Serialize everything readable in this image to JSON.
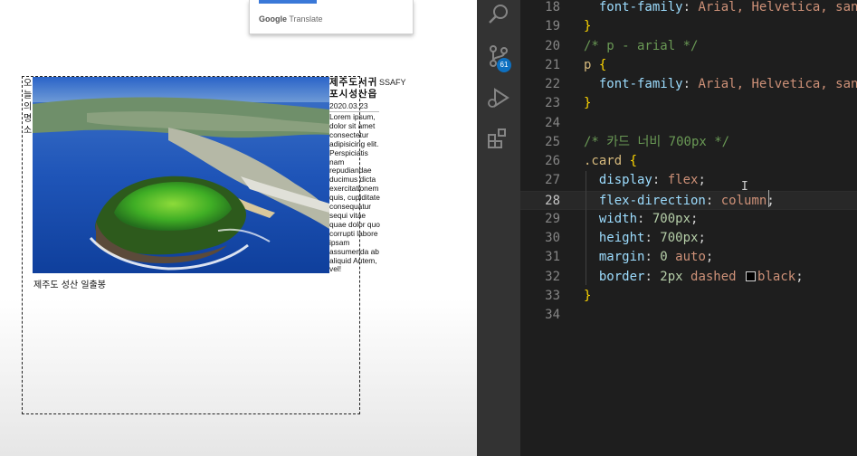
{
  "translate_popup": {
    "brand": "Google",
    "product": "Translate"
  },
  "card": {
    "vertical_heading": "오늘의명소",
    "photo_caption": "제주도 성산 일출봉",
    "side_title": "제주도서귀포시성산읍",
    "date": "2020.03.23",
    "body_text": "Lorem ipsum, dolor sit amet consectetur adipisicing elit. Perspiciatis nam repudiandae ducimus dicta exercitationem quis, cupiditate consequatur sequi vitae quae dolor quo corrupti labore ipsam assumenda ab aliquid Autem, vel!"
  },
  "ssafy_label": "SSAFY",
  "activity_bar": {
    "icons": [
      "search-icon",
      "source-control-icon",
      "run-debug-icon",
      "extensions-icon"
    ],
    "scm_badge": "61"
  },
  "editor": {
    "colors": {
      "brace": "#ffd700",
      "property": "#9cdcfe",
      "value": "#ce9178",
      "selector": "#d7ba7d",
      "comment": "#6a9955",
      "number": "#b5cea8"
    },
    "lines": [
      {
        "n": "18",
        "t": "  font-family: Arial, Helvetica, san"
      },
      {
        "n": "19",
        "t": "}"
      },
      {
        "n": "20",
        "t": "/* p - arial */"
      },
      {
        "n": "21",
        "t": "p {"
      },
      {
        "n": "22",
        "t": "  font-family: Arial, Helvetica, san"
      },
      {
        "n": "23",
        "t": "}"
      },
      {
        "n": "24",
        "t": ""
      },
      {
        "n": "25",
        "t": "/* 카드 너비 700px */"
      },
      {
        "n": "26",
        "t": ".card {"
      },
      {
        "n": "27",
        "t": "  display: flex;"
      },
      {
        "n": "28",
        "t": "  flex-direction: column;"
      },
      {
        "n": "29",
        "t": "  width: 700px;"
      },
      {
        "n": "30",
        "t": "  height: 700px;"
      },
      {
        "n": "31",
        "t": "  margin: 0 auto;"
      },
      {
        "n": "32",
        "t": "  border: 2px dashed black;"
      },
      {
        "n": "33",
        "t": "}"
      },
      {
        "n": "34",
        "t": ""
      }
    ],
    "current_line": "28"
  }
}
